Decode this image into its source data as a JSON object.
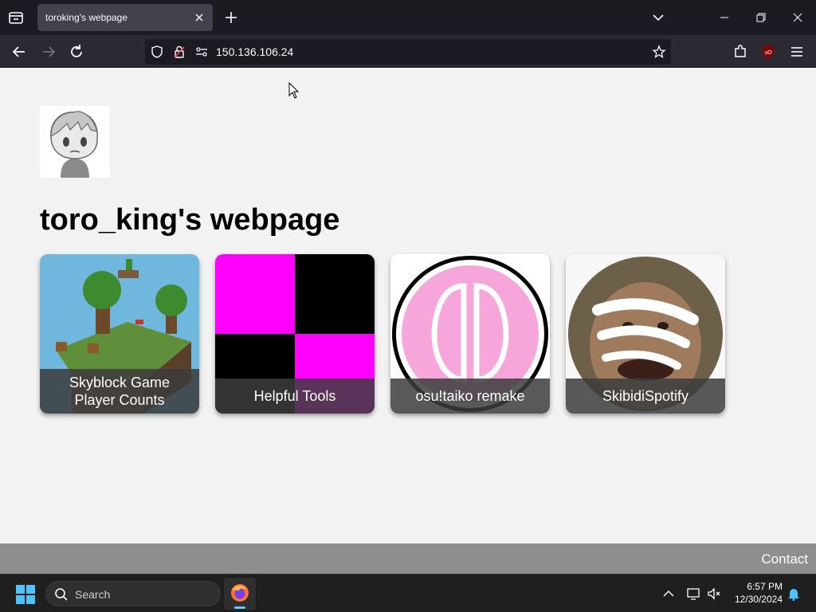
{
  "browser": {
    "tab_title": "toroking's webpage",
    "url": "150.136.106.24"
  },
  "icons": {
    "tab_list": "tab-list-icon",
    "tab_close": "close-icon",
    "new_tab": "plus-icon",
    "back": "arrow-left-icon",
    "forward": "arrow-right-icon",
    "reload": "reload-icon",
    "shield": "shield-icon",
    "lock": "lock-icon",
    "permissions": "permissions-icon",
    "bookmark": "star-icon",
    "extensions": "puzzle-icon",
    "ublock": "ublock-icon",
    "menu": "hamburger-icon"
  },
  "page": {
    "title": "toro_king's webpage",
    "cards": [
      {
        "label": "Skyblock Game Player Counts"
      },
      {
        "label": "Helpful Tools"
      },
      {
        "label": "osu!taiko remake"
      },
      {
        "label": "SkibidiSpotify"
      }
    ],
    "footer_link": "Contact"
  },
  "taskbar": {
    "search_placeholder": "Search",
    "time": "6:57 PM",
    "date": "12/30/2024"
  },
  "colors": {
    "page_bg": "#f2f2f2",
    "footer_bg": "#8e8e8e",
    "magenta": "#ff00ff",
    "osu_pink": "#f7a6dc"
  }
}
